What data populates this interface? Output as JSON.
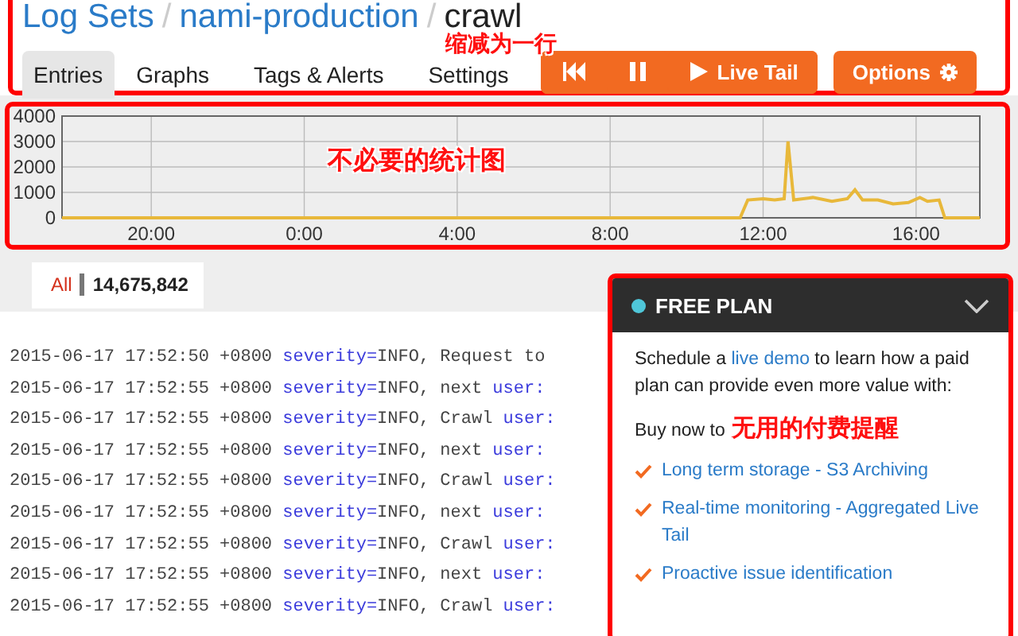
{
  "header": {
    "breadcrumb": [
      {
        "kind": "link",
        "text": "Log Sets"
      },
      {
        "kind": "sep",
        "text": "/"
      },
      {
        "kind": "link",
        "text": "nami-production"
      },
      {
        "kind": "sep",
        "text": "/"
      },
      {
        "kind": "current",
        "text": "crawl"
      }
    ],
    "tabs": [
      {
        "label": "Entries",
        "selected": true
      },
      {
        "label": "Graphs",
        "selected": false
      },
      {
        "label": "Tags & Alerts",
        "selected": false
      },
      {
        "label": "Settings",
        "selected": false
      }
    ],
    "live_tail": "Live Tail",
    "options": "Options",
    "note": "缩减为一行"
  },
  "chart_panel": {
    "note": "不必要的统计图",
    "chart_data": {
      "type": "line",
      "grid": true,
      "x": [
        "2015-06-16 17:40",
        "2015-06-17 11:24",
        "2015-06-17 11:36",
        "2015-06-17 12:00",
        "2015-06-17 12:18",
        "2015-06-17 12:33",
        "2015-06-17 12:39",
        "2015-06-17 12:48",
        "2015-06-17 13:18",
        "2015-06-17 13:48",
        "2015-06-17 14:12",
        "2015-06-17 14:24",
        "2015-06-17 14:36",
        "2015-06-17 15:00",
        "2015-06-17 15:24",
        "2015-06-17 15:48",
        "2015-06-17 16:06",
        "2015-06-17 16:18",
        "2015-06-17 16:36",
        "2015-06-17 16:45",
        "2015-06-17 17:40"
      ],
      "series": [
        {
          "color": "#e8b83a",
          "values": [
            0,
            0,
            700,
            750,
            700,
            750,
            3000,
            700,
            800,
            650,
            750,
            1100,
            700,
            700,
            550,
            600,
            800,
            650,
            700,
            0,
            0
          ]
        }
      ],
      "xlim": [
        "2015-06-16 17:40",
        "2015-06-17 17:40"
      ],
      "ylim": [
        0,
        4000
      ],
      "yticks": [
        0,
        1000,
        2000,
        3000,
        4000
      ],
      "xticks": [
        {
          "value": "2015-06-16 20:00",
          "label": "20:00"
        },
        {
          "value": "2015-06-17 00:00",
          "label": "0:00"
        },
        {
          "value": "2015-06-17 04:00",
          "label": "4:00"
        },
        {
          "value": "2015-06-17 08:00",
          "label": "8:00"
        },
        {
          "value": "2015-06-17 12:00",
          "label": "12:00"
        },
        {
          "value": "2015-06-17 16:00",
          "label": "16:00"
        }
      ]
    }
  },
  "filter_tab": {
    "label": "All",
    "count": "14,675,842"
  },
  "log_rows": [
    {
      "segments": [
        {
          "kind": "plain",
          "text": "2015-06-17 17:52:50 +0800"
        },
        {
          "kind": "key",
          "text": "severity="
        },
        {
          "kind": "plain",
          "text": "INFO,"
        },
        {
          "kind": "plain",
          "text": "Request to"
        }
      ]
    },
    {
      "segments": [
        {
          "kind": "plain",
          "text": "2015-06-17 17:52:55 +0800"
        },
        {
          "kind": "key",
          "text": "severity="
        },
        {
          "kind": "plain",
          "text": "INFO,"
        },
        {
          "kind": "plain",
          "text": "next"
        },
        {
          "kind": "key",
          "text": "user:"
        }
      ]
    },
    {
      "segments": [
        {
          "kind": "plain",
          "text": "2015-06-17 17:52:55 +0800"
        },
        {
          "kind": "key",
          "text": "severity="
        },
        {
          "kind": "plain",
          "text": "INFO,"
        },
        {
          "kind": "plain",
          "text": "Crawl"
        },
        {
          "kind": "key",
          "text": "user:"
        }
      ]
    },
    {
      "segments": [
        {
          "kind": "plain",
          "text": "2015-06-17 17:52:55 +0800"
        },
        {
          "kind": "key",
          "text": "severity="
        },
        {
          "kind": "plain",
          "text": "INFO,"
        },
        {
          "kind": "plain",
          "text": "next"
        },
        {
          "kind": "key",
          "text": "user:"
        }
      ]
    },
    {
      "segments": [
        {
          "kind": "plain",
          "text": "2015-06-17 17:52:55 +0800"
        },
        {
          "kind": "key",
          "text": "severity="
        },
        {
          "kind": "plain",
          "text": "INFO,"
        },
        {
          "kind": "plain",
          "text": "Crawl"
        },
        {
          "kind": "key",
          "text": "user:"
        }
      ]
    },
    {
      "segments": [
        {
          "kind": "plain",
          "text": "2015-06-17 17:52:55 +0800"
        },
        {
          "kind": "key",
          "text": "severity="
        },
        {
          "kind": "plain",
          "text": "INFO,"
        },
        {
          "kind": "plain",
          "text": "next"
        },
        {
          "kind": "key",
          "text": "user:"
        }
      ]
    },
    {
      "segments": [
        {
          "kind": "plain",
          "text": "2015-06-17 17:52:55 +0800"
        },
        {
          "kind": "key",
          "text": "severity="
        },
        {
          "kind": "plain",
          "text": "INFO,"
        },
        {
          "kind": "plain",
          "text": "Crawl"
        },
        {
          "kind": "key",
          "text": "user:"
        }
      ]
    },
    {
      "segments": [
        {
          "kind": "plain",
          "text": "2015-06-17 17:52:55 +0800"
        },
        {
          "kind": "key",
          "text": "severity="
        },
        {
          "kind": "plain",
          "text": "INFO,"
        },
        {
          "kind": "plain",
          "text": "next"
        },
        {
          "kind": "key",
          "text": "user:"
        }
      ]
    },
    {
      "segments": [
        {
          "kind": "plain",
          "text": "2015-06-17 17:52:55 +0800"
        },
        {
          "kind": "key",
          "text": "severity="
        },
        {
          "kind": "plain",
          "text": "INFO,"
        },
        {
          "kind": "plain",
          "text": "Crawl"
        },
        {
          "kind": "key",
          "text": "user:"
        }
      ]
    }
  ],
  "plan_panel": {
    "title": "FREE PLAN",
    "intro_before": "Schedule a",
    "link": "live demo",
    "intro_after": "to learn how a paid plan can provide even more value with:",
    "buy": "Buy now to",
    "note": "无用的付费提醒",
    "items": [
      "Long term storage - S3 Archiving",
      "Real-time monitoring - Aggregated Live Tail",
      "Proactive issue identification"
    ]
  }
}
